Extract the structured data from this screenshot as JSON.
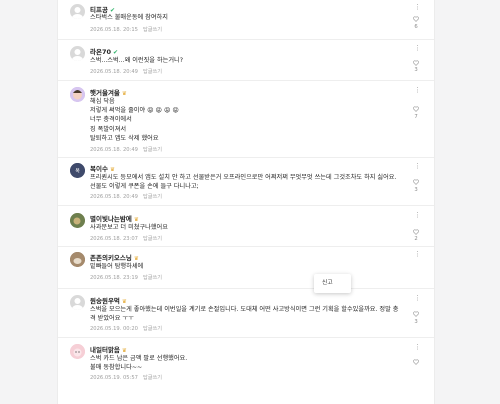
{
  "comments": [
    {
      "name": "티프공",
      "badge": "✔",
      "body": "스타벅스 불매운동에 참여하지",
      "date": "2026.05.18. 20:15",
      "reply": "답글쓰기",
      "likes": "6"
    },
    {
      "name": "라온70",
      "badge": "✔",
      "body": "스벅...스벅...왜 이런짓을 하는거니?",
      "date": "2026.05.18. 20:49",
      "reply": "답글쓰기",
      "likes": "3"
    },
    {
      "name": "햇거울겨울",
      "badge": "♛",
      "body": "해심 닥음\n저렇게 써먹을 줄이야 😡 😡 😡 😡\n너무 충격이에서\n징 폭발이져서\n탈퇴하고 앱도 삭제 했어요",
      "date": "2026.05.18. 20:49",
      "reply": "답글쓰기",
      "likes": "7"
    },
    {
      "name": "복이수",
      "badge": "♛",
      "body": "프리퀀시도 등모에서 앱도 설치 안 하고 선물받은거 오프라인으로만 어쩌저쩌 무엇무엇 쓰는데 그것조차도 하지 싫어요. 선물도 이렇게 쿠폰을 손에 들구 다니나고;",
      "date": "2026.05.18. 20:49",
      "reply": "답글쓰기",
      "likes": "3"
    },
    {
      "name": "별이빛나는밤에",
      "badge": "♛",
      "body": "사과문보고 더 미쳤구나했어요",
      "date": "2026.05.18. 23:07",
      "reply": "답글쓰기",
      "likes": "2"
    },
    {
      "name": "존존의키오스닝",
      "badge": "♛",
      "body": "밑빠들어 탐행하셰에",
      "date": "2026.05.18. 23:19",
      "reply": "답글쓰기",
      "likes": ""
    },
    {
      "name": "원숭원우먹",
      "badge": "♛",
      "body": "스벅을 모으는게 좋아했는데 이번일을 계기로 손절입니다. 도대체 어떤 사고방식이면 그런 기획을 할수있을까요. 정말 충격 받았어요 ㅜㅜ",
      "date": "2026.05.19. 00:20",
      "reply": "답글쓰기",
      "likes": "3"
    },
    {
      "name": "내일터맑음",
      "badge": "♛",
      "body": "스벅 카드 남은 금액 팔로 선행했어요.\n불매 동참합니다~~",
      "date": "2026.05.19. 05:57",
      "reply": "답글쓰기",
      "likes": ""
    }
  ],
  "popup": {
    "report_label": "신고"
  },
  "icons": {
    "more": "more-vertical-icon",
    "like": "heart-icon",
    "verified": "verified-check-icon",
    "grade": "grade-crown-icon"
  },
  "colors": {
    "verified": "#31b46b",
    "grade": "#e3a72f",
    "meta": "#a0a0a0"
  }
}
